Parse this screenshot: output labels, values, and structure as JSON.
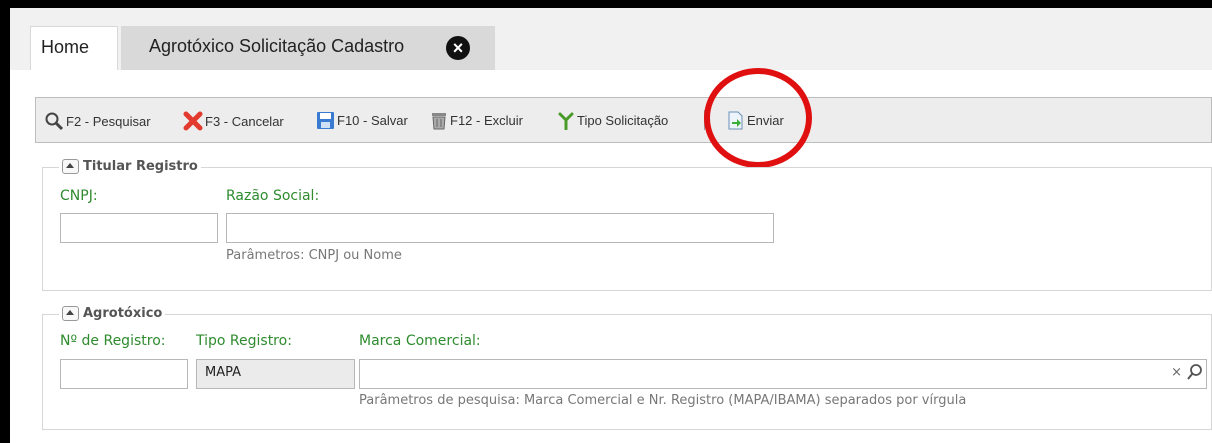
{
  "tabs": [
    {
      "label": "Home"
    },
    {
      "label": "Agrotóxico Solicitação Cadastro",
      "close_icon": "close-circle-icon"
    }
  ],
  "toolbar": {
    "pesquisar": {
      "label": "F2 - Pesquisar",
      "icon": "magnifier-icon"
    },
    "cancelar": {
      "label": "F3 - Cancelar",
      "icon": "red-x-icon"
    },
    "salvar": {
      "label": "F10 - Salvar",
      "icon": "floppy-icon"
    },
    "excluir": {
      "label": "F12 - Excluir",
      "icon": "trash-icon"
    },
    "tipo": {
      "label": "Tipo Solicitação",
      "icon": "fork-icon"
    },
    "enviar": {
      "label": "Enviar",
      "icon": "send-document-icon"
    }
  },
  "titular": {
    "legend": "Titular Registro",
    "cnpj_label": "CNPJ:",
    "cnpj_value": "",
    "razao_label": "Razão Social:",
    "razao_value": "",
    "hint": "Parâmetros: CNPJ ou Nome"
  },
  "agrotoxico": {
    "legend": "Agrotóxico",
    "registro_label": "Nº de Registro:",
    "registro_value": "",
    "tipo_label": "Tipo Registro:",
    "tipo_value": "MAPA",
    "marca_label": "Marca Comercial:",
    "marca_value": "",
    "clear_symbol": "×",
    "hint": "Parâmetros de pesquisa: Marca Comercial e Nr. Registro (MAPA/IBAMA) separados por vírgula"
  },
  "colors": {
    "label_green": "#2e8b2e",
    "annotation_red": "#e01010"
  }
}
